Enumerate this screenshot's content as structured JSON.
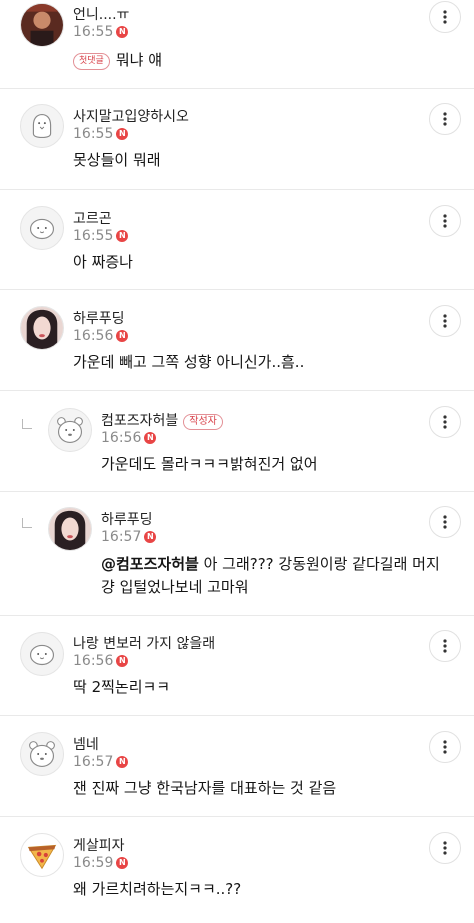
{
  "comments": [
    {
      "nick": "언니....ㅠ",
      "time": "16:55",
      "badge": "N",
      "first_label": "첫댓글",
      "text": "뭐냐 얘",
      "avatar": "photo-man-avatar"
    },
    {
      "nick": "사지말고입양하시오",
      "time": "16:55",
      "badge": "N",
      "text": "못상들이 뭐래",
      "avatar": "default-penguin-avatar"
    },
    {
      "nick": "고르곤",
      "time": "16:55",
      "badge": "N",
      "text": "아 짜증나",
      "avatar": "default-blob-avatar"
    },
    {
      "nick": "하루푸딩",
      "time": "16:56",
      "badge": "N",
      "text": "가운데 빼고 그쪽 성향 아니신가..흠..",
      "avatar": "photo-woman-avatar"
    },
    {
      "nick": "컴포즈자허블",
      "time": "16:56",
      "badge": "N",
      "author_label": "작성자",
      "text": "가운데도 몰라ㅋㅋㅋ밝혀진거 없어",
      "avatar": "default-bear-avatar",
      "reply": true
    },
    {
      "nick": "하루푸딩",
      "time": "16:57",
      "badge": "N",
      "mention": "@컴포즈자허블",
      "text_line1": " 아 그래??? 강동원이랑 같다길래 머지",
      "text_line2": "걍 입털었나보네 고마워",
      "avatar": "photo-woman-avatar",
      "reply": true
    },
    {
      "nick": "나랑 변보러 가지 않을래",
      "time": "16:56",
      "badge": "N",
      "text": "딱 2찍논리ㅋㅋ",
      "avatar": "default-blob-avatar"
    },
    {
      "nick": "넴네",
      "time": "16:57",
      "badge": "N",
      "text": "잰 진짜 그냥 한국남자를 대표하는 것 같음",
      "avatar": "default-bear-avatar"
    },
    {
      "nick": "게살피자",
      "time": "16:59",
      "badge": "N",
      "text": "왜 가르치려하는지ㅋㅋ..??",
      "avatar": "pizza-avatar"
    }
  ]
}
